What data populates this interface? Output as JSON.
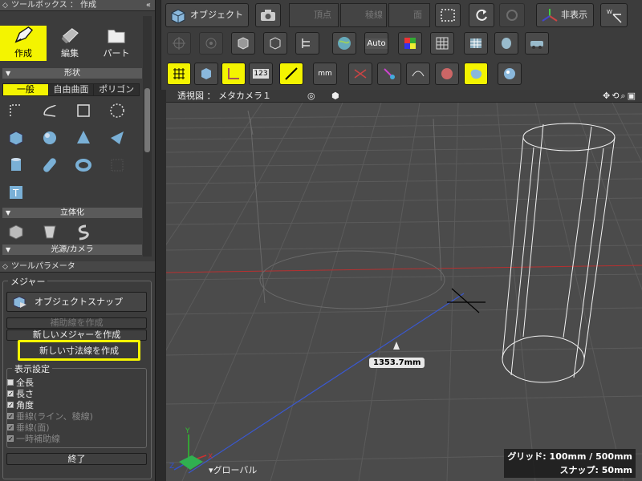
{
  "toolbox": {
    "title": "ツールボックス ： 作成"
  },
  "tool_tabs": [
    {
      "label": "作成",
      "icon": "pen-icon"
    },
    {
      "label": "編集",
      "icon": "eraser-icon"
    },
    {
      "label": "パート",
      "icon": "folder-icon"
    }
  ],
  "sections": {
    "shape": "形状",
    "solidify": "立体化",
    "light_camera": "光源/カメラ"
  },
  "shape_tabs": [
    "一般",
    "自由曲面",
    "ポリゴン"
  ],
  "params": {
    "title": "ツールパラメータ",
    "group": "メジャー",
    "snap_button": "オブジェクトスナップ",
    "aux_button": "補助線を作成",
    "new_measure_button": "新しいメジャーを作成",
    "new_dim_button": "新しい寸法線を作成",
    "display_group": "表示設定",
    "checks": [
      {
        "label": "全長",
        "checked": false,
        "disabled": false
      },
      {
        "label": "長さ",
        "checked": true,
        "disabled": false
      },
      {
        "label": "角度",
        "checked": true,
        "disabled": false
      },
      {
        "label": "垂線(ライン、稜線)",
        "checked": true,
        "disabled": true
      },
      {
        "label": "垂線(面)",
        "checked": true,
        "disabled": true
      },
      {
        "label": "一時補助線",
        "checked": true,
        "disabled": true
      }
    ],
    "end_button": "終了"
  },
  "toolbar": {
    "object_label": "オブジェクト",
    "vertex_label": "頂点",
    "edge_label": "稜線",
    "face_label": "面",
    "hide_label": "非表示",
    "auto_label": "Auto",
    "num_label": "123",
    "mm_label": "mm"
  },
  "viewport": {
    "header": "透視図 ： メタカメラ１",
    "dimension": "1353.7mm",
    "axis_label": "グローバル",
    "grid_info": "グリッド: 100mm / 500mm",
    "snap_info": "スナップ: 50mm"
  },
  "colors": {
    "accent": "#f4f400",
    "x_axis": "#c03030",
    "y_axis": "#30a030",
    "z_axis": "#3050c0"
  }
}
